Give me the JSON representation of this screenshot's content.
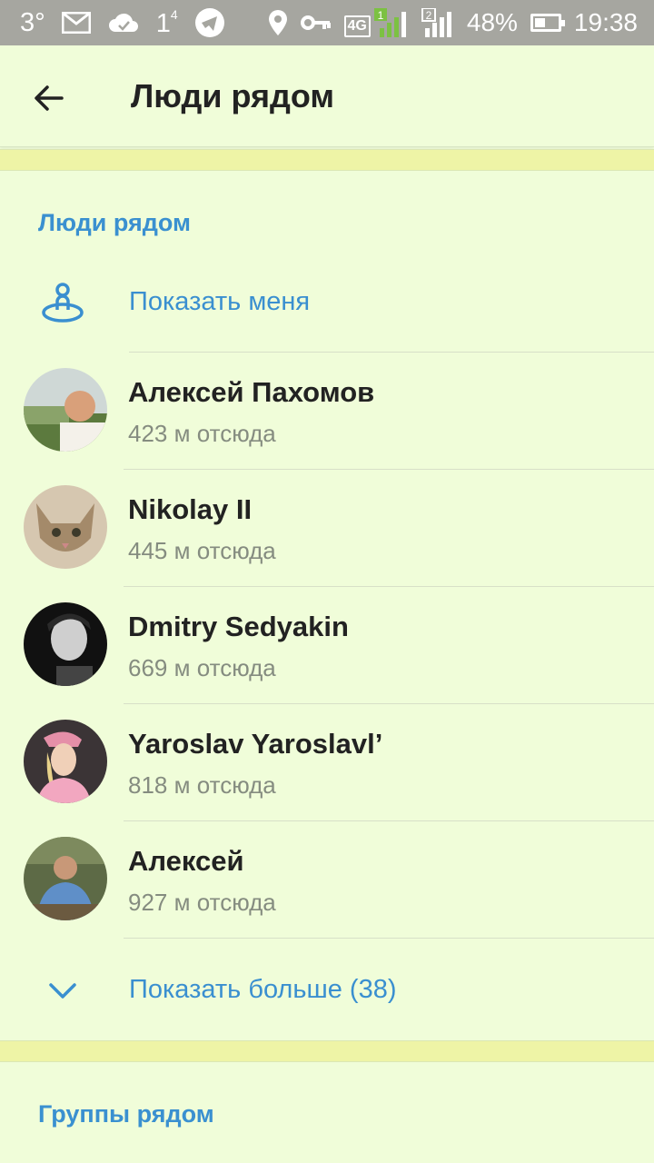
{
  "status_bar": {
    "temperature": "3°",
    "notification_count": "1",
    "notification_sup": "4",
    "network_4g": "4G",
    "sim1": "1",
    "sim2": "2",
    "battery": "48%",
    "time": "19:38"
  },
  "header": {
    "title": "Люди рядом"
  },
  "people_section": {
    "header": "Люди рядом",
    "show_me": "Показать меня",
    "people": [
      {
        "name": "Алексей Пахомов",
        "distance": "423 м отсюда"
      },
      {
        "name": "Nikolay II",
        "distance": "445 м отсюда"
      },
      {
        "name": "Dmitry Sedyakin",
        "distance": "669 м отсюда"
      },
      {
        "name": "Yaroslav Yaroslavl’",
        "distance": "818 м отсюда"
      },
      {
        "name": "Алексей",
        "distance": "927 м отсюда"
      }
    ],
    "show_more": "Показать больше (38)"
  },
  "groups_section": {
    "header": "Группы рядом"
  },
  "colors": {
    "background": "#f0fdd9",
    "accent": "#3a90d0",
    "divider_band": "#eef4a6",
    "status_bar": "#a6a6a0"
  }
}
